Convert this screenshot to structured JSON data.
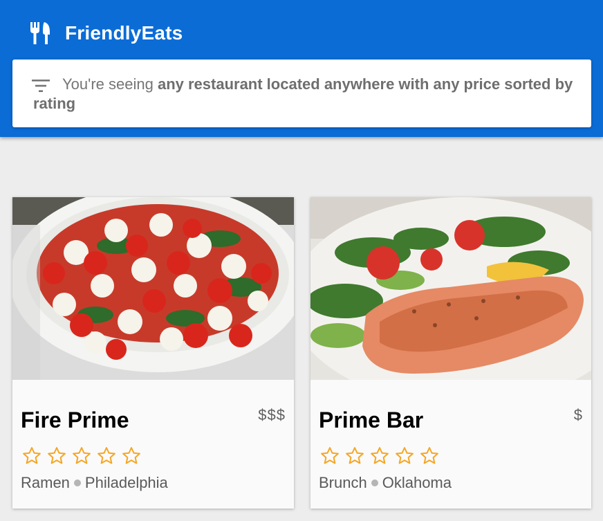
{
  "app": {
    "title": "FriendlyEats",
    "icon": "restaurant-icon"
  },
  "filter": {
    "icon": "filter-icon",
    "prefix": "You're seeing ",
    "description": "any restaurant located anywhere with any price sorted by rating"
  },
  "restaurants": [
    {
      "name": "Fire Prime",
      "price": "$$$",
      "category": "Ramen",
      "city": "Philadelphia",
      "rating": 0,
      "max_rating": 5,
      "photo": "caprese-salad-photo"
    },
    {
      "name": "Prime Bar",
      "price": "$",
      "category": "Brunch",
      "city": "Oklahoma",
      "rating": 0,
      "max_rating": 5,
      "photo": "grilled-salmon-photo"
    }
  ],
  "colors": {
    "primary": "#0b6cd6",
    "star": "#f5a623",
    "background": "#ededed"
  }
}
